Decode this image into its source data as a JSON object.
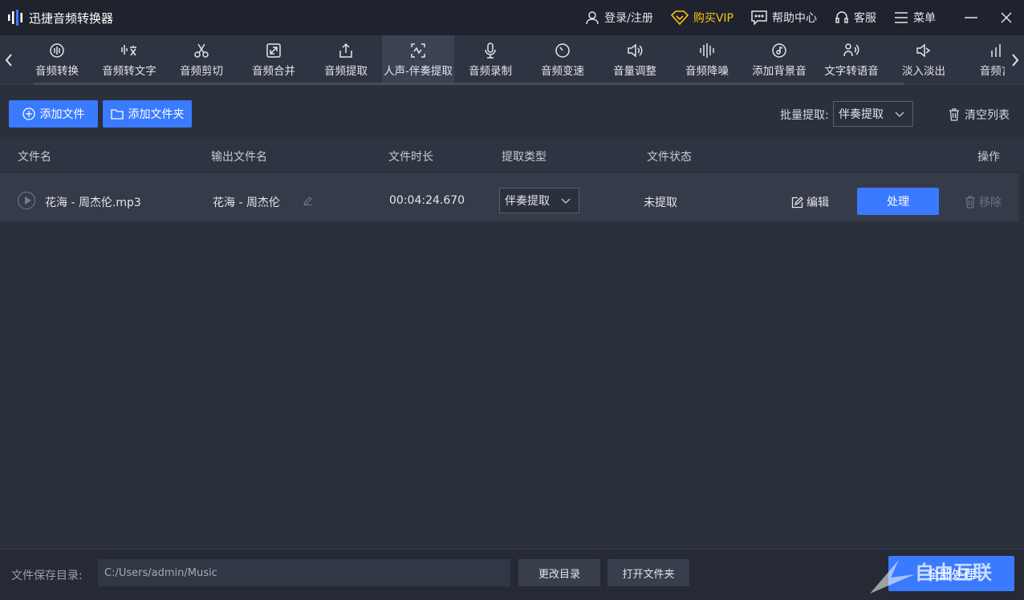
{
  "app": {
    "title": "迅捷音频转换器"
  },
  "title_actions": {
    "login": "登录/注册",
    "vip": "购买VIP",
    "help": "帮助中心",
    "service": "客服",
    "menu": "菜单"
  },
  "toolbar": {
    "tools": [
      {
        "label": "音频转换",
        "icon": "audio-convert-icon"
      },
      {
        "label": "音频转文字",
        "icon": "audio-to-text-icon"
      },
      {
        "label": "音频剪切",
        "icon": "scissors-icon"
      },
      {
        "label": "音频合并",
        "icon": "merge-icon"
      },
      {
        "label": "音频提取",
        "icon": "extract-icon"
      },
      {
        "label": "人声-伴奏提取",
        "icon": "vocal-extract-icon",
        "active": true
      },
      {
        "label": "音频录制",
        "icon": "microphone-icon"
      },
      {
        "label": "音频变速",
        "icon": "speed-icon"
      },
      {
        "label": "音量调整",
        "icon": "volume-icon"
      },
      {
        "label": "音频降噪",
        "icon": "denoise-icon"
      },
      {
        "label": "添加背景音",
        "icon": "background-music-icon"
      },
      {
        "label": "文字转语音",
        "icon": "text-to-speech-icon"
      },
      {
        "label": "淡入淡出",
        "icon": "fade-icon"
      },
      {
        "label": "音频言",
        "icon": "audio-bars-icon"
      }
    ]
  },
  "actions": {
    "add_file": "添加文件",
    "add_folder": "添加文件夹",
    "batch_label": "批量提取:",
    "batch_value": "伴奏提取",
    "clear_list": "清空列表"
  },
  "table": {
    "headers": {
      "filename": "文件名",
      "output": "输出文件名",
      "duration": "文件时长",
      "type": "提取类型",
      "status": "文件状态",
      "ops": "操作"
    },
    "rows": [
      {
        "filename": "花海 - 周杰伦.mp3",
        "output": "花海 - 周杰伦",
        "duration": "00:04:24.670",
        "type": "伴奏提取",
        "status": "未提取",
        "edit": "编辑",
        "process": "处理",
        "remove": "移除"
      }
    ]
  },
  "bottom": {
    "save_label": "文件保存目录:",
    "save_path": "C:/Users/admin/Music",
    "change_dir": "更改目录",
    "open_folder": "打开文件夹",
    "process_all": "全部处理"
  },
  "watermark": {
    "text": "自由互联"
  },
  "colors": {
    "accent": "#3a7afe",
    "vip": "#f5c518",
    "bg": "#2b303d",
    "titlebar": "#1f232d"
  }
}
